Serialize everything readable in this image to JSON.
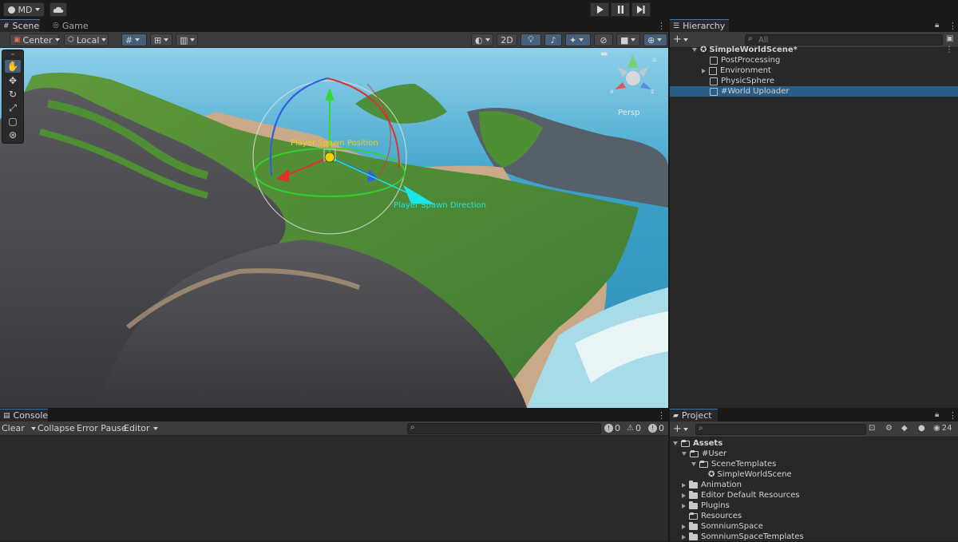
{
  "topbar": {
    "account_label": "MD",
    "account_icon": "user-circle-icon",
    "cloud_icon": "cloud-icon",
    "play_icon": "play-icon",
    "pause_icon": "pause-icon",
    "step_icon": "step-icon"
  },
  "scene_panel": {
    "tabs": [
      {
        "label": "Scene",
        "icon": "grid-icon"
      },
      {
        "label": "Game",
        "icon": "gamepad-icon"
      }
    ],
    "pivot_mode": "Center",
    "pivot_rotation": "Local",
    "mode_2d": "2D"
  },
  "scene": {
    "gizmo_label_position": "Player Spawn Position",
    "gizmo_label_direction": "Player Spawn Direction",
    "view_axis_y": "y",
    "view_axis_x": "x",
    "view_axis_z": "z",
    "projection_label": "Persp"
  },
  "hierarchy": {
    "tab_label": "Hierarchy",
    "search_placeholder": "All",
    "scene_name": "SimpleWorldScene*",
    "items": [
      {
        "label": "PostProcessing",
        "expandable": false
      },
      {
        "label": "Environment",
        "expandable": true
      },
      {
        "label": "PhysicSphere",
        "expandable": false
      },
      {
        "label": "#World Uploader",
        "expandable": false,
        "selected": true
      }
    ]
  },
  "console": {
    "tab_label": "Console",
    "clear_label": "Clear",
    "collapse_label": "Collapse",
    "error_pause_label": "Error Pause",
    "editor_label": "Editor",
    "info_count": "0",
    "warning_count": "0",
    "error_count": "0"
  },
  "project": {
    "tab_label": "Project",
    "count_label": "24",
    "tree": [
      {
        "label": "Assets",
        "level": 0,
        "arrow": "down",
        "open": true,
        "bold": true
      },
      {
        "label": "#User",
        "level": 1,
        "arrow": "down",
        "open": true
      },
      {
        "label": "SceneTemplates",
        "level": 2,
        "arrow": "down",
        "open": true
      },
      {
        "label": "SimpleWorldScene",
        "level": 3,
        "arrow": "none",
        "unity": true
      },
      {
        "label": "Animation",
        "level": 1,
        "arrow": "right"
      },
      {
        "label": "Editor Default Resources",
        "level": 1,
        "arrow": "right"
      },
      {
        "label": "Plugins",
        "level": 1,
        "arrow": "right"
      },
      {
        "label": "Resources",
        "level": 1,
        "arrow": "none"
      },
      {
        "label": "SomniumSpace",
        "level": 1,
        "arrow": "right"
      },
      {
        "label": "SomniumSpaceTemplates",
        "level": 1,
        "arrow": "right"
      }
    ]
  },
  "colors": {
    "selection": "#2c5d87",
    "gizmo_yellow": "#e8d400",
    "gizmo_cyan": "#19e6e6"
  }
}
